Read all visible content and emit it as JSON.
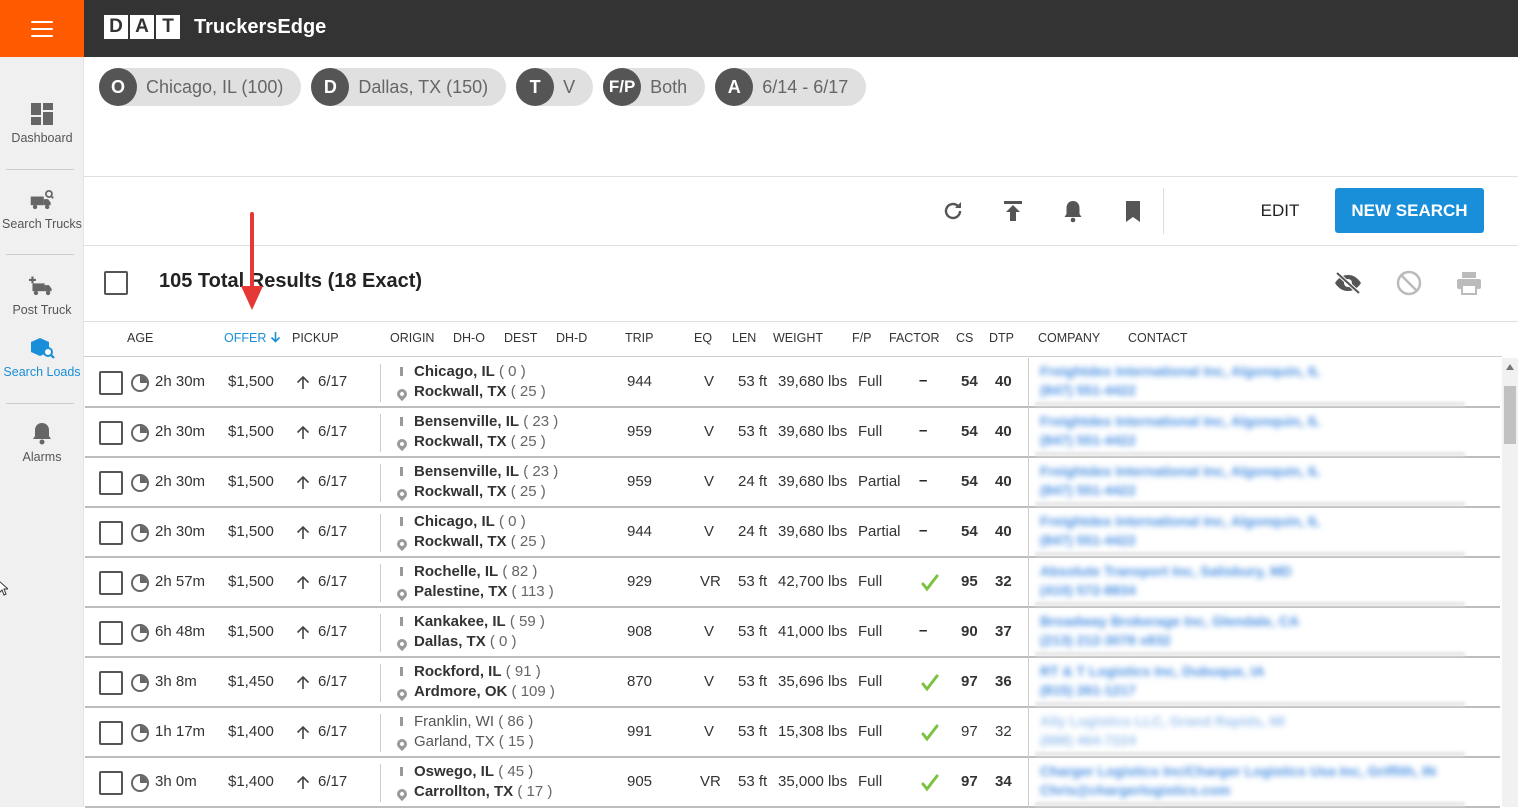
{
  "app": {
    "title": "TruckersEdge",
    "logo_letters": [
      "D",
      "A",
      "T"
    ]
  },
  "sidebar": {
    "items": [
      {
        "label": "Dashboard",
        "icon": "dashboard-icon"
      },
      {
        "label": "Search Trucks",
        "icon": "truck-search-icon"
      },
      {
        "label": "Post Truck",
        "icon": "post-truck-icon"
      },
      {
        "label": "Search Loads",
        "icon": "box-search-icon"
      },
      {
        "label": "Alarms",
        "icon": "bell-icon"
      }
    ]
  },
  "search_chips": [
    {
      "abbr": "O",
      "value": "Chicago, IL (100)"
    },
    {
      "abbr": "D",
      "value": "Dallas, TX (150)"
    },
    {
      "abbr": "T",
      "value": "V"
    },
    {
      "abbr": "F/P",
      "value": "Both"
    },
    {
      "abbr": "A",
      "value": "6/14 - 6/17"
    }
  ],
  "toolbar": {
    "edit_label": "EDIT",
    "new_search_label": "NEW SEARCH",
    "icons": [
      "refresh-icon",
      "upload-icon",
      "bell-icon",
      "bookmark-icon"
    ]
  },
  "results": {
    "summary": "105 Total Results (18 Exact)"
  },
  "columns": [
    "AGE",
    "OFFER",
    "PICKUP",
    "ORIGIN",
    "DH-O",
    "DEST",
    "DH-D",
    "TRIP",
    "EQ",
    "LEN",
    "WEIGHT",
    "F/P",
    "FACTOR",
    "CS",
    "DTP",
    "COMPANY",
    "CONTACT"
  ],
  "rows": [
    {
      "age": "2h 30m",
      "offer": "$1,500",
      "pickup": "6/17",
      "origin": "Chicago, IL",
      "dho": "( 0 )",
      "dest": "Rockwall, TX",
      "dhd": "( 25 )",
      "trip": "944",
      "eq": "V",
      "len": "53 ft",
      "weight": "39,680 lbs",
      "fp": "Full",
      "factor": "–",
      "cs": "54",
      "dtp": "40",
      "company": "Freightdex International Inc, Algonquin, IL",
      "contact": "(847) 551-4422"
    },
    {
      "age": "2h 30m",
      "offer": "$1,500",
      "pickup": "6/17",
      "origin": "Bensenville, IL",
      "dho": "( 23 )",
      "dest": "Rockwall, TX",
      "dhd": "( 25 )",
      "trip": "959",
      "eq": "V",
      "len": "53 ft",
      "weight": "39,680 lbs",
      "fp": "Full",
      "factor": "–",
      "cs": "54",
      "dtp": "40",
      "company": "Freightdex International Inc, Algonquin, IL",
      "contact": "(847) 551-4422"
    },
    {
      "age": "2h 30m",
      "offer": "$1,500",
      "pickup": "6/17",
      "origin": "Bensenville, IL",
      "dho": "( 23 )",
      "dest": "Rockwall, TX",
      "dhd": "( 25 )",
      "trip": "959",
      "eq": "V",
      "len": "24 ft",
      "weight": "39,680 lbs",
      "fp": "Partial",
      "factor": "–",
      "cs": "54",
      "dtp": "40",
      "company": "Freightdex International Inc, Algonquin, IL",
      "contact": "(847) 551-4422"
    },
    {
      "age": "2h 30m",
      "offer": "$1,500",
      "pickup": "6/17",
      "origin": "Chicago, IL",
      "dho": "( 0 )",
      "dest": "Rockwall, TX",
      "dhd": "( 25 )",
      "trip": "944",
      "eq": "V",
      "len": "24 ft",
      "weight": "39,680 lbs",
      "fp": "Partial",
      "factor": "–",
      "cs": "54",
      "dtp": "40",
      "company": "Freightdex International Inc, Algonquin, IL",
      "contact": "(847) 551-4422"
    },
    {
      "age": "2h 57m",
      "offer": "$1,500",
      "pickup": "6/17",
      "origin": "Rochelle, IL",
      "dho": "( 82 )",
      "dest": "Palestine, TX",
      "dhd": "( 113 )",
      "trip": "929",
      "eq": "VR",
      "len": "53 ft",
      "weight": "42,700 lbs",
      "fp": "Full",
      "factor": "✔",
      "cs": "95",
      "dtp": "32",
      "company": "Absolute Transport Inc, Salisbury, MD",
      "contact": "(410) 572-8834"
    },
    {
      "age": "6h 48m",
      "offer": "$1,500",
      "pickup": "6/17",
      "origin": "Kankakee, IL",
      "dho": "( 59 )",
      "dest": "Dallas, TX",
      "dhd": "( 0 )",
      "trip": "908",
      "eq": "V",
      "len": "53 ft",
      "weight": "41,000 lbs",
      "fp": "Full",
      "factor": "–",
      "cs": "90",
      "dtp": "37",
      "company": "Broadway Brokerage Inc, Glendale, CA",
      "contact": "(213) 212-3078 x832"
    },
    {
      "age": "3h 8m",
      "offer": "$1,450",
      "pickup": "6/17",
      "origin": "Rockford, IL",
      "dho": "( 91 )",
      "dest": "Ardmore, OK",
      "dhd": "( 109 )",
      "trip": "870",
      "eq": "V",
      "len": "53 ft",
      "weight": "35,696 lbs",
      "fp": "Full",
      "factor": "✔",
      "cs": "97",
      "dtp": "36",
      "company": "RT & T Logistics Inc, Dubuque, IA",
      "contact": "(815) 261-1217"
    },
    {
      "age": "1h 17m",
      "offer": "$1,400",
      "pickup": "6/17",
      "origin": "Franklin, WI",
      "dho": "( 86 )",
      "dest": "Garland, TX",
      "dhd": "( 15 )",
      "trip": "991",
      "eq": "V",
      "len": "53 ft",
      "weight": "15,308 lbs",
      "fp": "Full",
      "factor": "✔",
      "cs": "97",
      "dtp": "32",
      "company": "Ally Logistics LLC, Grand Rapids, MI",
      "contact": "(888) 464-7224"
    },
    {
      "age": "3h 0m",
      "offer": "$1,400",
      "pickup": "6/17",
      "origin": "Oswego, IL",
      "dho": "( 45 )",
      "dest": "Carrollton, TX",
      "dhd": "( 17 )",
      "trip": "905",
      "eq": "VR",
      "len": "53 ft",
      "weight": "35,000 lbs",
      "fp": "Full",
      "factor": "✔",
      "cs": "97",
      "dtp": "34",
      "company": "Charger Logistics Inc/Charger Logistics Usa Inc, Griffith, IN",
      "contact": "Chris@chargerlogistics.com"
    }
  ],
  "colors": {
    "accent": "#1a8fd9",
    "brand_orange": "#ff5a00",
    "header_dark": "#333333",
    "check_green": "#7cc242",
    "annotation_red": "#e53935"
  }
}
